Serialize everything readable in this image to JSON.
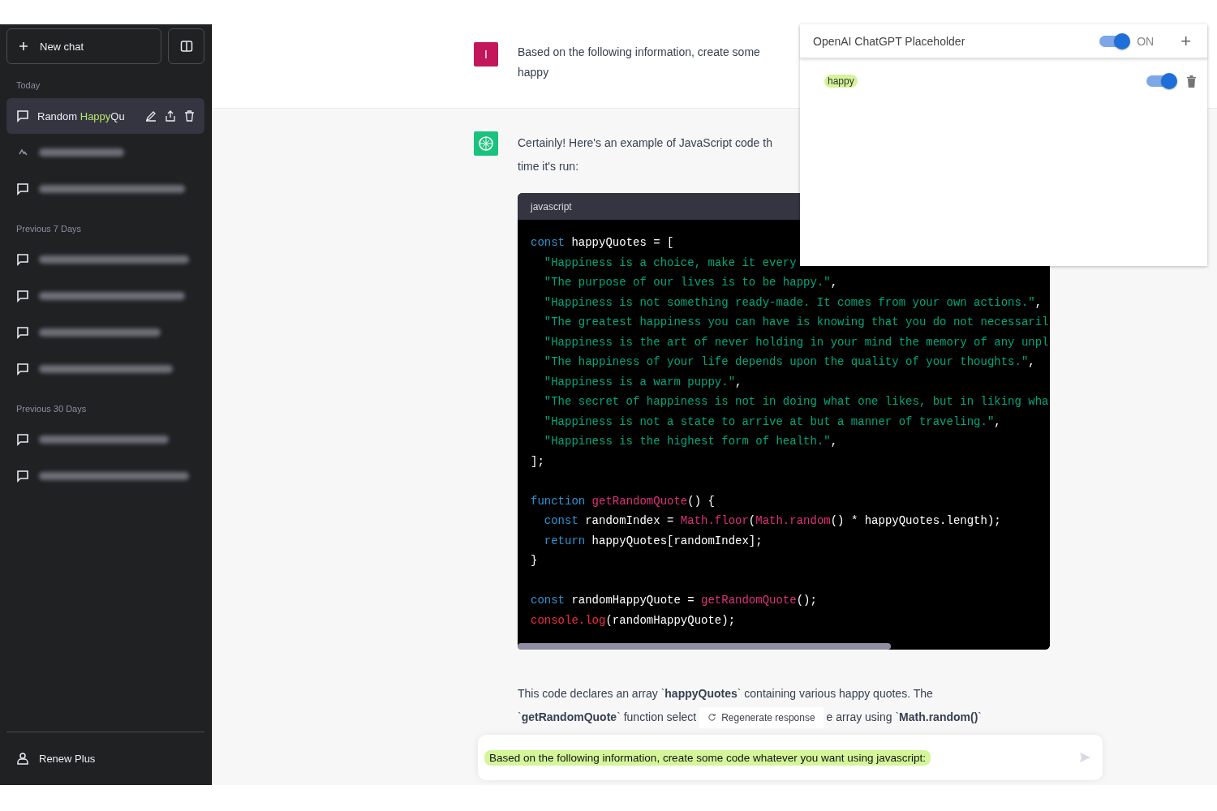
{
  "sidebar": {
    "new_chat": "New chat",
    "groups": [
      {
        "label": "Today",
        "items": [
          {
            "kind": "title",
            "selected": true,
            "segments": [
              {
                "text": "Random ",
                "highlighted": false
              },
              {
                "text": "Happy",
                "highlighted": true
              },
              {
                "text": "Qu",
                "highlighted": false
              }
            ]
          },
          {
            "kind": "draft",
            "selected": false
          },
          {
            "kind": "blurred",
            "selected": false
          }
        ]
      },
      {
        "label": "Previous 7 Days",
        "items": [
          {
            "kind": "blurred",
            "selected": false
          },
          {
            "kind": "blurred",
            "selected": false
          },
          {
            "kind": "blurred",
            "selected": false
          },
          {
            "kind": "blurred",
            "selected": false
          }
        ]
      },
      {
        "label": "Previous 30 Days",
        "items": [
          {
            "kind": "blurred",
            "selected": false
          },
          {
            "kind": "blurred",
            "selected": false
          }
        ]
      }
    ],
    "account": "Renew Plus"
  },
  "user_message": {
    "avatar": "I",
    "lines": [
      "Based on the following information, create some",
      "happy"
    ]
  },
  "assistant_message": {
    "intro_lines": [
      "Certainly! Here's an example of JavaScript code th",
      "time it's run:"
    ],
    "code": {
      "language": "javascript",
      "lines": [
        {
          "kind": "code",
          "tokens": [
            {
              "t": "const",
              "kind": "keyword"
            },
            {
              "t": " happyQuotes = [",
              "kind": "plain"
            }
          ]
        },
        {
          "kind": "code",
          "tokens": [
            {
              "t": "  \"Happiness is a choice, make it every",
              "kind": "string"
            }
          ]
        },
        {
          "kind": "code",
          "tokens": [
            {
              "t": "  \"The purpose of our lives is to be happy.\"",
              "kind": "string"
            },
            {
              "t": ",",
              "kind": "plain"
            }
          ]
        },
        {
          "kind": "code",
          "tokens": [
            {
              "t": "  \"Happiness is not something ready-made. It comes from your own actions.\"",
              "kind": "string"
            },
            {
              "t": ",",
              "kind": "plain"
            }
          ]
        },
        {
          "kind": "code",
          "tokens": [
            {
              "t": "  \"The greatest happiness you can have is knowing that you do not necessaril",
              "kind": "string"
            }
          ]
        },
        {
          "kind": "code",
          "tokens": [
            {
              "t": "  \"Happiness is the art of never holding in your mind the memory of any unpl",
              "kind": "string"
            }
          ]
        },
        {
          "kind": "code",
          "tokens": [
            {
              "t": "  \"The happiness of your life depends upon the quality of your thoughts.\"",
              "kind": "string"
            },
            {
              "t": ",",
              "kind": "plain"
            }
          ]
        },
        {
          "kind": "code",
          "tokens": [
            {
              "t": "  \"Happiness is a warm puppy.\"",
              "kind": "string"
            },
            {
              "t": ",",
              "kind": "plain"
            }
          ]
        },
        {
          "kind": "code",
          "tokens": [
            {
              "t": "  \"The secret of happiness is not in doing what one likes, but in liking wha",
              "kind": "string"
            }
          ]
        },
        {
          "kind": "code",
          "tokens": [
            {
              "t": "  \"Happiness is not a state to arrive at but a manner of traveling.\"",
              "kind": "string"
            },
            {
              "t": ",",
              "kind": "plain"
            }
          ]
        },
        {
          "kind": "code",
          "tokens": [
            {
              "t": "  \"Happiness is the highest form of health.\"",
              "kind": "string"
            },
            {
              "t": ",",
              "kind": "plain"
            }
          ]
        },
        {
          "kind": "code",
          "tokens": [
            {
              "t": "];",
              "kind": "plain"
            }
          ]
        },
        {
          "kind": "blank"
        },
        {
          "kind": "code",
          "tokens": [
            {
              "t": "function",
              "kind": "keyword"
            },
            {
              "t": " getRandomQuote",
              "kind": "func"
            },
            {
              "t": "() {",
              "kind": "plain"
            }
          ]
        },
        {
          "kind": "code",
          "tokens": [
            {
              "t": "  const",
              "kind": "keyword"
            },
            {
              "t": " randomIndex = ",
              "kind": "plain"
            },
            {
              "t": "Math.floor",
              "kind": "func"
            },
            {
              "t": "(",
              "kind": "plain"
            },
            {
              "t": "Math.random",
              "kind": "func"
            },
            {
              "t": "() * happyQuotes.length);",
              "kind": "plain"
            }
          ]
        },
        {
          "kind": "code",
          "tokens": [
            {
              "t": "  return",
              "kind": "keyword"
            },
            {
              "t": " happyQuotes[randomIndex];",
              "kind": "plain"
            }
          ]
        },
        {
          "kind": "code",
          "tokens": [
            {
              "t": "}",
              "kind": "plain"
            }
          ]
        },
        {
          "kind": "blank"
        },
        {
          "kind": "code",
          "tokens": [
            {
              "t": "const",
              "kind": "keyword"
            },
            {
              "t": " randomHappyQuote = ",
              "kind": "plain"
            },
            {
              "t": "getRandomQuote",
              "kind": "func"
            },
            {
              "t": "();",
              "kind": "plain"
            }
          ]
        },
        {
          "kind": "code",
          "tokens": [
            {
              "t": "console.log",
              "kind": "builtin"
            },
            {
              "t": "(randomHappyQuote);",
              "kind": "plain"
            }
          ]
        }
      ]
    },
    "outro_line_1": "This code declares an array `**happyQuotes**` containing various happy quotes. The",
    "outro_line_2_start": "`**getRandomQuote**` function select",
    "outro_line_2_end": "e array using `**Math.random()**`"
  },
  "regenerate": "Regenerate response",
  "composer": {
    "value": "Based on the following information, create some code whatever you want using javascript:",
    "highlighted": true
  },
  "extension": {
    "title": "OpenAI ChatGPT Placeholder",
    "enabled": true,
    "state_label": "ON",
    "add": "+",
    "rules": [
      {
        "word": "happy",
        "enabled": true
      }
    ]
  }
}
